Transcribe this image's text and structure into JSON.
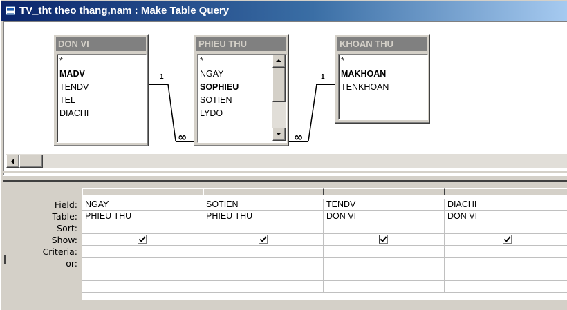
{
  "window": {
    "title": "TV_tht theo thang,nam : Make Table Query",
    "icon": "table-query-icon"
  },
  "tables": [
    {
      "name": "DON VI",
      "fields": [
        {
          "label": "*",
          "key": false
        },
        {
          "label": "MADV",
          "key": true
        },
        {
          "label": "TENDV",
          "key": false
        },
        {
          "label": "TEL",
          "key": false
        },
        {
          "label": "DIACHI",
          "key": false
        }
      ]
    },
    {
      "name": "PHIEU THU",
      "fields": [
        {
          "label": "*",
          "key": false
        },
        {
          "label": "NGAY",
          "key": false
        },
        {
          "label": "SOPHIEU",
          "key": true
        },
        {
          "label": "SOTIEN",
          "key": false
        },
        {
          "label": "LYDO",
          "key": false
        }
      ]
    },
    {
      "name": "KHOAN THU",
      "fields": [
        {
          "label": "*",
          "key": false
        },
        {
          "label": "MAKHOAN",
          "key": true
        },
        {
          "label": "TENKHOAN",
          "key": false
        }
      ]
    }
  ],
  "joins": {
    "one_label": "1",
    "many_label": "∞"
  },
  "grid": {
    "row_labels": [
      "Field:",
      "Table:",
      "Sort:",
      "Show:",
      "Criteria:",
      "or:"
    ],
    "columns": [
      {
        "field": "NGAY",
        "table": "PHIEU THU",
        "sort": "",
        "show": true,
        "criteria": "",
        "or": ""
      },
      {
        "field": "SOTIEN",
        "table": "PHIEU THU",
        "sort": "",
        "show": true,
        "criteria": "",
        "or": ""
      },
      {
        "field": "TENDV",
        "table": "DON VI",
        "sort": "",
        "show": true,
        "criteria": "",
        "or": ""
      },
      {
        "field": "DIACHI",
        "table": "DON VI",
        "sort": "",
        "show": true,
        "criteria": "",
        "or": ""
      }
    ]
  },
  "colors": {
    "titlebar_start": "#0a246a",
    "titlebar_end": "#a6caf0",
    "chrome": "#d4d0c8",
    "table_title_bg": "#808080"
  }
}
